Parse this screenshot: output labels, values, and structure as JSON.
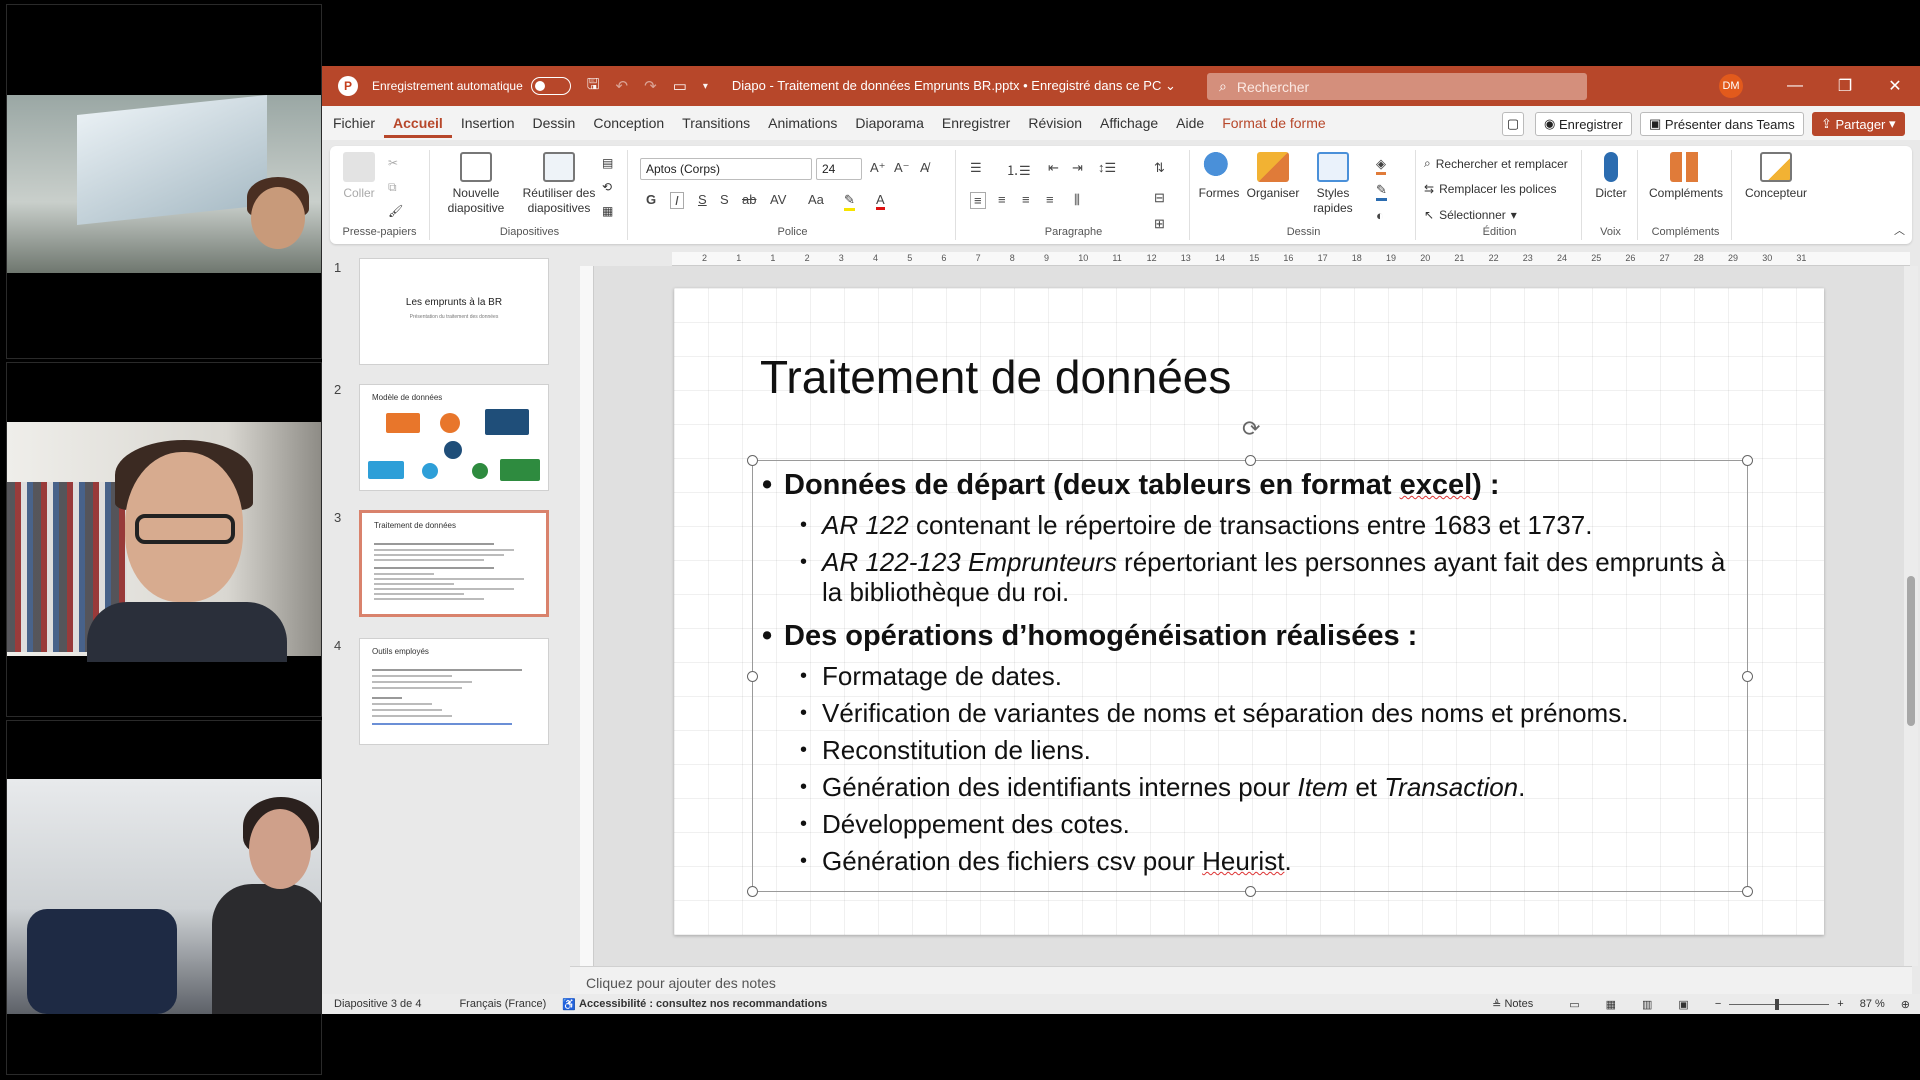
{
  "window": {
    "autosave_label": "Enregistrement automatique",
    "doc_title": "Diapo - Traitement de données Emprunts BR.pptx • Enregistré dans ce PC ⌄",
    "search_placeholder": "Rechercher",
    "user_initials": "DM"
  },
  "menu": {
    "items": [
      "Fichier",
      "Accueil",
      "Insertion",
      "Dessin",
      "Conception",
      "Transitions",
      "Animations",
      "Diaporama",
      "Enregistrer",
      "Révision",
      "Affichage",
      "Aide",
      "Format de forme"
    ],
    "record_button": "Enregistrer",
    "teams_button": "Présenter dans Teams",
    "share_button": "Partager"
  },
  "ribbon": {
    "paste": "Coller",
    "clipboard_group": "Presse-papiers",
    "new_slide": "Nouvelle diapositive",
    "reuse_slides": "Réutiliser des diapositives",
    "slides_group": "Diapositives",
    "font_name": "Aptos (Corps)",
    "font_size": "24",
    "font_group": "Police",
    "paragraph_group": "Paragraphe",
    "shapes": "Formes",
    "arrange": "Organiser",
    "quick_styles": "Styles rapides",
    "drawing_group": "Dessin",
    "find_replace": "Rechercher et remplacer",
    "replace_fonts": "Remplacer les polices",
    "select": "Sélectionner",
    "editing_group": "Édition",
    "dictate": "Dicter",
    "voice_group": "Voix",
    "addins": "Compléments",
    "addins_group": "Compléments",
    "designer": "Concepteur",
    "bold": "G",
    "italic": "I",
    "underline": "S",
    "strike": "S"
  },
  "thumbnails": {
    "numbers": [
      "1",
      "2",
      "3",
      "4"
    ],
    "slide1_title": "Les emprunts à la BR",
    "slide1_sub": "Présentation du traitement des données",
    "slide2_title": "Modèle de données",
    "slide3_title": "Traitement de données",
    "slide4_title": "Outils employés"
  },
  "slide": {
    "title": "Traitement de données",
    "b1": "Données de départ (deux tableurs en format ",
    "b1_excel": "excel",
    "b1_end": ") :",
    "s1_it": "AR 122",
    "s1_rest": " contenant le répertoire de transactions entre 1683 et 1737.",
    "s2_it": "AR 122-123 Emprunteurs",
    "s2_rest": " répertoriant les personnes ayant fait des emprunts à la bibliothèque du roi.",
    "b2": "Des opérations d’homogénéisation réalisées :",
    "s3": "Formatage de dates.",
    "s4": "Vérification de variantes de noms et séparation des noms et prénoms.",
    "s5": "Reconstitution de liens.",
    "s6_a": "Génération des identifiants internes pour ",
    "s6_item": "Item",
    "s6_b": " et ",
    "s6_trans": "Transaction",
    "s6_c": ".",
    "s7": "Développement des cotes.",
    "s8_a": "Génération des fichiers csv pour ",
    "s8_heurist": "Heurist",
    "s8_b": "."
  },
  "notes_placeholder": "Cliquez pour ajouter des notes",
  "status": {
    "slide_of": "Diapositive 3 de 4",
    "language": "Français (France)",
    "accessibility": "Accessibilité : consultez nos recommandations",
    "notes": "Notes",
    "zoom": "87 %"
  },
  "ruler_marks": [
    "2",
    "1",
    "1",
    "2",
    "3",
    "4",
    "5",
    "6",
    "7",
    "8",
    "9",
    "10",
    "11",
    "12",
    "13",
    "14",
    "15",
    "16",
    "17",
    "18",
    "19",
    "20",
    "21",
    "22",
    "23",
    "24",
    "25",
    "26",
    "27",
    "28",
    "29",
    "30",
    "31"
  ],
  "colors": {
    "accent": "#b7472a",
    "selection": "#d9826c"
  }
}
